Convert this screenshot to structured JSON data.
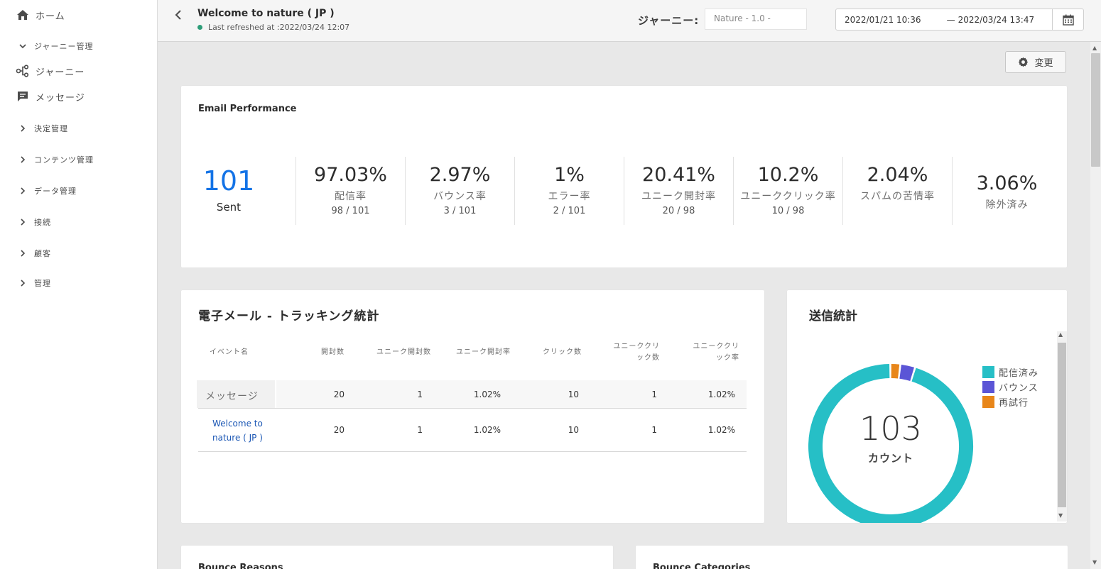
{
  "sidebar": {
    "items": [
      {
        "label": "ホーム"
      },
      {
        "label": "ジャーニー管理"
      },
      {
        "label": "ジャーニー"
      },
      {
        "label": "メッセージ"
      },
      {
        "label": "決定管理"
      },
      {
        "label": "コンテンツ管理"
      },
      {
        "label": "データ管理"
      },
      {
        "label": "接続"
      },
      {
        "label": "顧客"
      },
      {
        "label": "管理"
      }
    ]
  },
  "header": {
    "title": "Welcome to nature ( JP )",
    "refreshed": "Last refreshed at :2022/03/24 12:07",
    "journey_label": "ジャーニー:",
    "journey_placeholder": "Nature - 1.0 -",
    "date_from": "2022/01/21 10:36",
    "date_sep": "—",
    "date_to": "2022/03/24 13:47"
  },
  "change_button": "変更",
  "email_performance": {
    "title": "Email Performance",
    "sent_value": "101",
    "sent_label": "Sent",
    "kpis": [
      {
        "value": "97.03%",
        "label": "配信率",
        "frac": "98  /  101"
      },
      {
        "value": "2.97%",
        "label": "バウンス率",
        "frac": "3 / 101"
      },
      {
        "value": "1%",
        "label": "エラー率",
        "frac": "2 / 101"
      },
      {
        "value": "20.41%",
        "label": "ユニーク開封率",
        "frac": "20 / 98"
      },
      {
        "value": "10.2%",
        "label": "ユニーククリック率",
        "frac": "10 / 98"
      },
      {
        "value": "2.04%",
        "label": "スパムの苦情率",
        "frac": ""
      },
      {
        "value": "3.06%",
        "label": "除外済み",
        "frac": ""
      }
    ]
  },
  "tracking": {
    "title": "電子メール - トラッキング統計",
    "headers": [
      "イベント名",
      "開封数",
      "ユニーク開封数",
      "ユニーク開封率",
      "クリック数",
      "ユニーククリック数",
      "ユニーククリック率"
    ],
    "header_lines": {
      "h5a": "ユニーククリ",
      "h5b": "ック数",
      "h6a": "ユニーククリ",
      "h6b": "ック率"
    },
    "rows": [
      {
        "name": "メッセージ",
        "opens": "20",
        "unique_opens": "1",
        "unique_open_rate": "1.02%",
        "clicks": "10",
        "unique_clicks": "1",
        "unique_click_rate": "1.02%"
      },
      {
        "name_line1": "Welcome to",
        "name_line2": "nature ( JP )",
        "opens": "20",
        "unique_opens": "1",
        "unique_open_rate": "1.02%",
        "clicks": "10",
        "unique_clicks": "1",
        "unique_click_rate": "1.02%"
      }
    ]
  },
  "send_stats": {
    "title": "送信統計",
    "total": "103",
    "total_label": "カウント",
    "legend": [
      {
        "label": "配信済み",
        "color": "#26bfc6"
      },
      {
        "label": "バウンス",
        "color": "#5b55d6"
      },
      {
        "label": "再試行",
        "color": "#e8861a"
      }
    ]
  },
  "chart_data": {
    "type": "pie",
    "title": "送信統計",
    "categories": [
      "配信済み",
      "バウンス",
      "再試行"
    ],
    "values": [
      98,
      3,
      2
    ],
    "colors": [
      "#26bfc6",
      "#5b55d6",
      "#e8861a"
    ],
    "center_value": "103",
    "center_label": "カウント",
    "legend": "right"
  },
  "bottom_cards": {
    "left_title": "Bounce Reasons",
    "right_title": "Bounce Categories"
  }
}
